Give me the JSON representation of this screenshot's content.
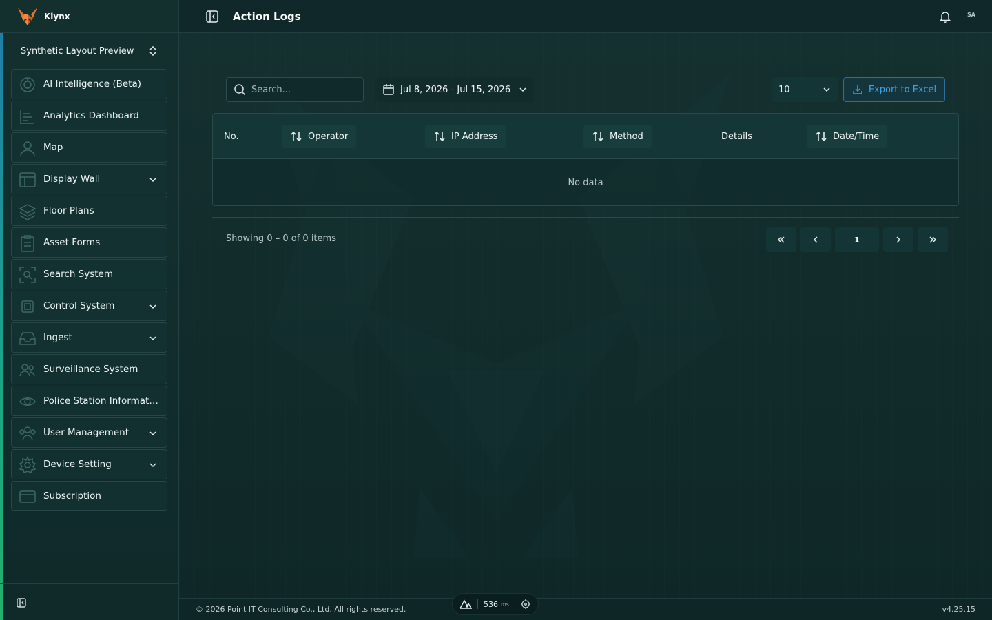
{
  "brand": {
    "name": "Klynx"
  },
  "workspace": {
    "name": "Synthetic Layout Preview"
  },
  "nav": [
    {
      "label": "AI Intelligence (Beta)",
      "icon": "ai-icon",
      "expandable": false
    },
    {
      "label": "Analytics Dashboard",
      "icon": "chart-icon",
      "expandable": false
    },
    {
      "label": "Map",
      "icon": "user-pin-icon",
      "expandable": false
    },
    {
      "label": "Display Wall",
      "icon": "layout-icon",
      "expandable": true
    },
    {
      "label": "Floor Plans",
      "icon": "layers-icon",
      "expandable": false
    },
    {
      "label": "Asset Forms",
      "icon": "clipboard-icon",
      "expandable": false
    },
    {
      "label": "Search System",
      "icon": "scan-search-icon",
      "expandable": false
    },
    {
      "label": "Control System",
      "icon": "chip-icon",
      "expandable": true
    },
    {
      "label": "Ingest",
      "icon": "inbox-icon",
      "expandable": true
    },
    {
      "label": "Surveillance System",
      "icon": "users-icon",
      "expandable": false
    },
    {
      "label": "Police Station Informati...",
      "icon": "eye-icon",
      "expandable": false
    },
    {
      "label": "User Management",
      "icon": "user-group-icon",
      "expandable": true
    },
    {
      "label": "Device Setting",
      "icon": "gear-icon",
      "expandable": true
    },
    {
      "label": "Subscription",
      "icon": "card-icon",
      "expandable": false
    }
  ],
  "header": {
    "title": "Action Logs",
    "avatar": "SA"
  },
  "toolbar": {
    "search_placeholder": "Search...",
    "date_range": "Jul 8, 2026 - Jul 15, 2026",
    "page_size": "10",
    "export_label": "Export to Excel"
  },
  "table": {
    "columns": [
      {
        "label": "No.",
        "sortable": false
      },
      {
        "label": "Operator",
        "sortable": true
      },
      {
        "label": "IP Address",
        "sortable": true
      },
      {
        "label": "Method",
        "sortable": true
      },
      {
        "label": "Details",
        "sortable": false
      },
      {
        "label": "Date/Time",
        "sortable": true
      }
    ],
    "rows": [],
    "empty_text": "No data"
  },
  "pagination": {
    "summary": "Showing 0 – 0 of 0 items",
    "current_page": "1"
  },
  "footer": {
    "copyright": "© 2026 Point IT Consulting Co., Ltd. All rights reserved.",
    "version": "v4.25.15",
    "perf_ms": "536",
    "perf_unit": "ms"
  },
  "colors": {
    "accent_blue": "#3aa3e8",
    "background": "#0f2628",
    "sidebar_gradient_top": "#1e7fa8",
    "sidebar_gradient_bottom": "#23b06c"
  }
}
